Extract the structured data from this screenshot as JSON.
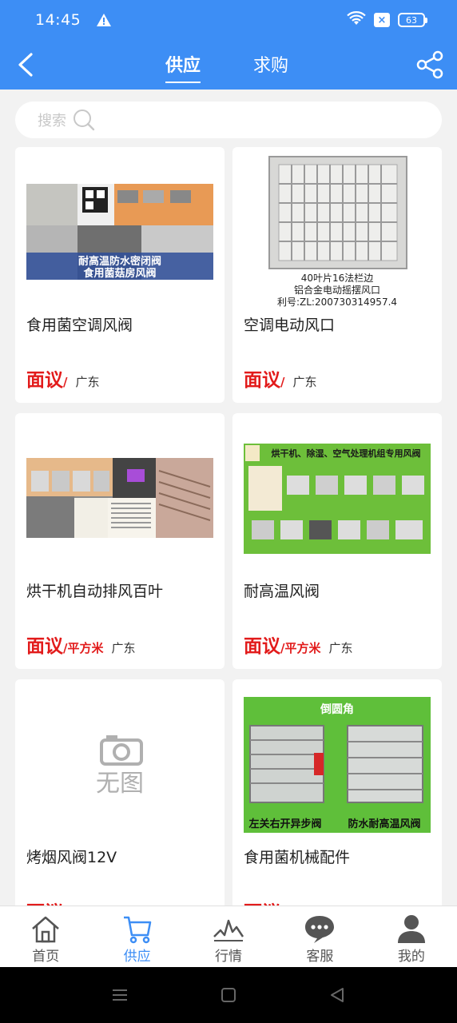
{
  "status_bar": {
    "time": "14:45",
    "sim_label": "×",
    "battery": "63"
  },
  "navbar": {
    "tab_supply": "供应",
    "tab_buy": "求购"
  },
  "search": {
    "placeholder": "搜索"
  },
  "products": [
    {
      "title": "食用菌空调风阀",
      "price": "面议",
      "unit": "/",
      "region": "广东",
      "image_caption": [
        "耐高温防水密闭阀",
        "食用菌菇房风阀"
      ]
    },
    {
      "title": "空调电动风口",
      "price": "面议",
      "unit": "/",
      "region": "广东",
      "image_caption": [
        "40叶片16法栏边",
        "铝合金电动摇摆风口",
        "利号:ZL:200730314957.4"
      ]
    },
    {
      "title": "烘干机自动排风百叶",
      "price": "面议",
      "unit": "/平方米",
      "region": "广东",
      "image_caption": []
    },
    {
      "title": "耐高温风阀",
      "price": "面议",
      "unit": "/平方米",
      "region": "广东",
      "image_caption": [
        "烘干机、除湿、空气处理机组专用风阀"
      ]
    },
    {
      "title": "烤烟风阀12V",
      "price": "面议",
      "unit": "",
      "region": "",
      "image_caption": [
        "无图"
      ]
    },
    {
      "title": "食用菌机械配件",
      "price": "面议",
      "unit": "",
      "region": "",
      "image_caption": [
        "倒圆角",
        "左关右开异步阀",
        "防水耐高温风阀"
      ]
    }
  ],
  "tabbar": {
    "items": [
      {
        "label": "首页",
        "icon": "home-icon"
      },
      {
        "label": "供应",
        "icon": "cart-icon"
      },
      {
        "label": "行情",
        "icon": "chart-icon"
      },
      {
        "label": "客服",
        "icon": "chat-icon"
      },
      {
        "label": "我的",
        "icon": "user-icon"
      }
    ],
    "active_index": 1
  },
  "colors": {
    "brand_blue": "#3d8ef5",
    "price_red": "#e21b1b"
  }
}
